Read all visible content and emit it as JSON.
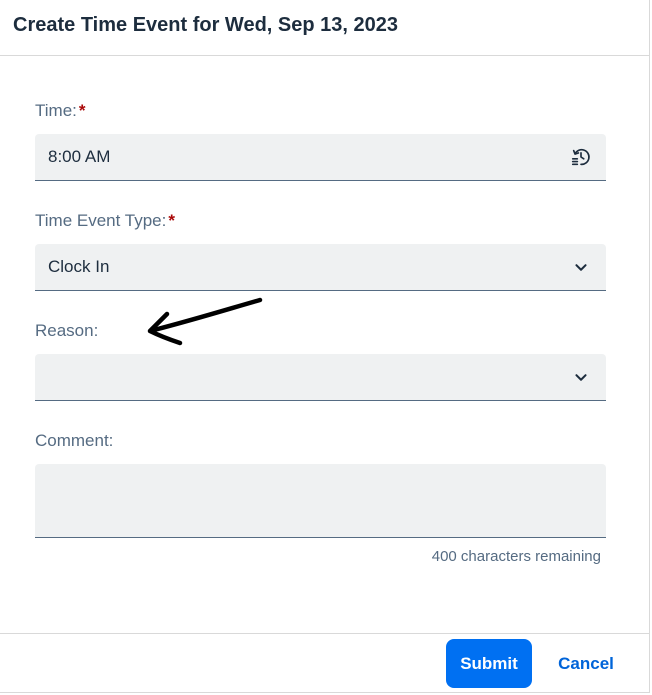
{
  "dialog": {
    "title": "Create Time Event for Wed, Sep 13, 2023"
  },
  "form": {
    "time": {
      "label": "Time:",
      "required_mark": "*",
      "value": "8:00 AM",
      "icon": "history-clock-icon"
    },
    "event_type": {
      "label": "Time Event Type:",
      "required_mark": "*",
      "value": "Clock In",
      "icon": "chevron-down-icon"
    },
    "reason": {
      "label": "Reason:",
      "value": "",
      "icon": "chevron-down-icon"
    },
    "comment": {
      "label": "Comment:",
      "value": "",
      "counter": "400 characters remaining"
    }
  },
  "footer": {
    "submit_label": "Submit",
    "cancel_label": "Cancel"
  },
  "colors": {
    "accent": "#0070f2",
    "link": "#0064d9",
    "required": "#aa0808",
    "field_bg": "#eff1f2",
    "label_text": "#556b82",
    "title_text": "#1d2d3e"
  }
}
